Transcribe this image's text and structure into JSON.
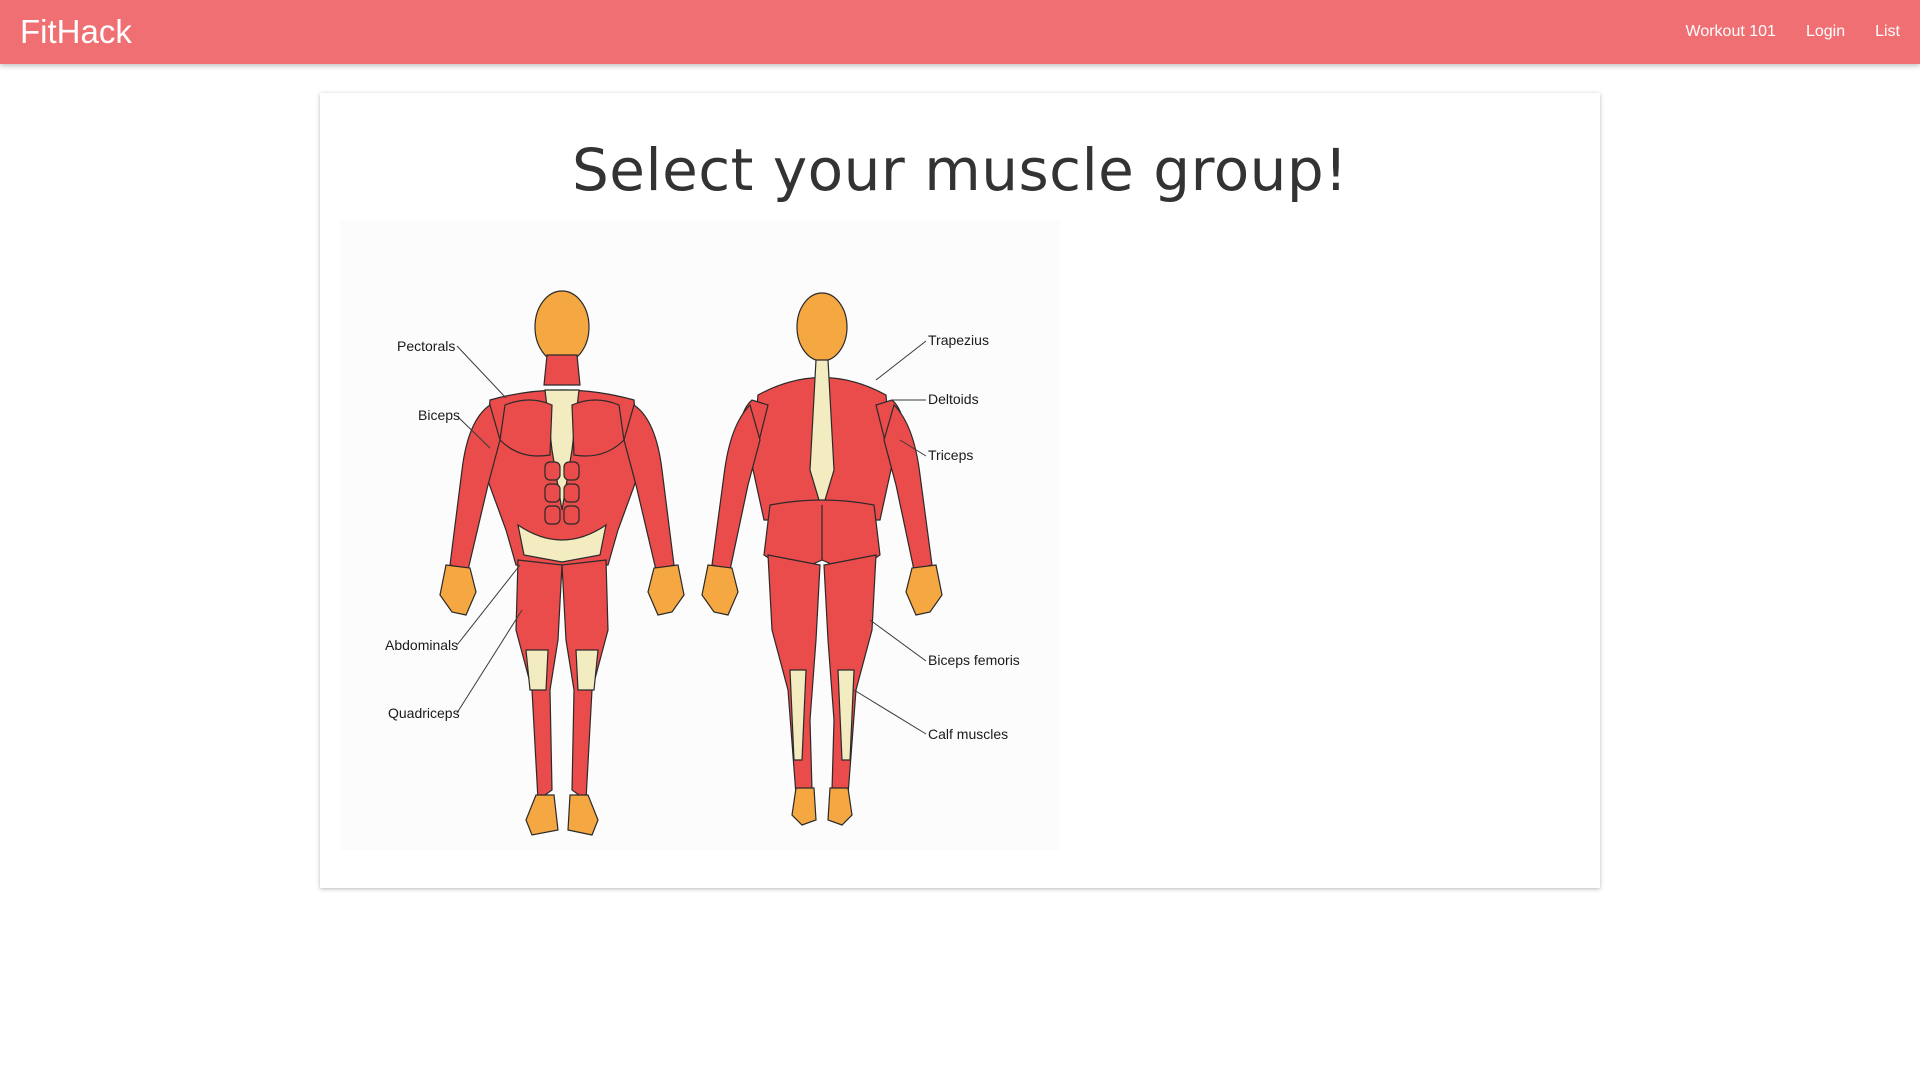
{
  "navbar": {
    "brand": "FitHack",
    "links": [
      "Workout 101",
      "Login",
      "List"
    ]
  },
  "main": {
    "title": "Select your muscle group!"
  },
  "diagram": {
    "labels": {
      "pectorals": "Pectorals",
      "biceps": "Biceps",
      "abdominals": "Abdominals",
      "quadriceps": "Quadriceps",
      "trapezius": "Trapezius",
      "deltoids": "Deltoids",
      "triceps": "Triceps",
      "biceps_femoris": "Biceps femoris",
      "calf_muscles": "Calf muscles"
    },
    "colors": {
      "muscle": "#ea4b4b",
      "skin": "#f5a742",
      "tendon": "#f3ecc0",
      "navbar": "#ef6f73"
    }
  }
}
